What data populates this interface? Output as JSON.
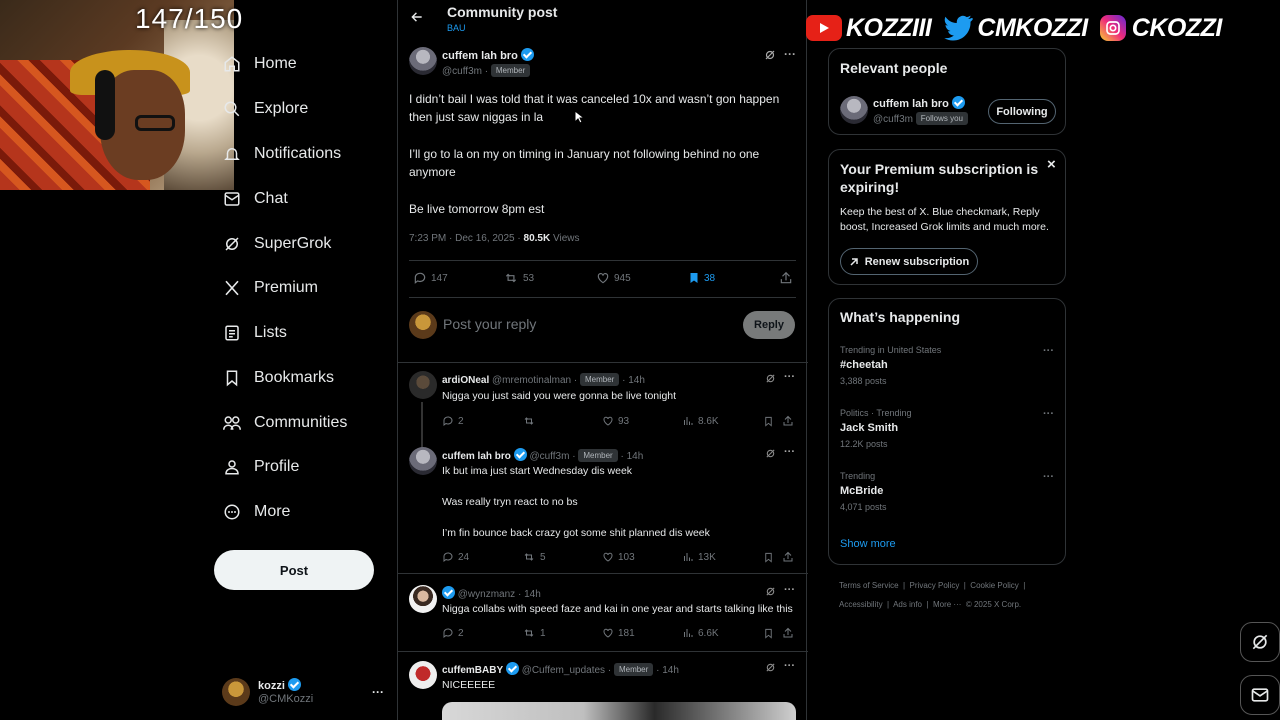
{
  "overlay": {
    "counter": "147/150",
    "banner": {
      "youtube": "KOZZIII",
      "twitter": "CMKOZZI",
      "instagram": "CKOZZI"
    }
  },
  "nav": {
    "items": [
      {
        "label": "Home",
        "icon": "home-icon"
      },
      {
        "label": "Explore",
        "icon": "search-icon"
      },
      {
        "label": "Notifications",
        "icon": "bell-icon"
      },
      {
        "label": "Chat",
        "icon": "chat-icon"
      },
      {
        "label": "SuperGrok",
        "icon": "grok-icon"
      },
      {
        "label": "Premium",
        "icon": "x-logo-icon"
      },
      {
        "label": "Lists",
        "icon": "lists-icon"
      },
      {
        "label": "Bookmarks",
        "icon": "bookmark-icon"
      },
      {
        "label": "Communities",
        "icon": "communities-icon"
      },
      {
        "label": "Profile",
        "icon": "profile-icon"
      },
      {
        "label": "More",
        "icon": "more-circle-icon"
      }
    ],
    "post_button": "Post",
    "account": {
      "name": "kozzi",
      "handle": "@CMKozzi",
      "more": "···"
    }
  },
  "header": {
    "title": "Community post",
    "subtitle": "BAU"
  },
  "main_post": {
    "author": "cuffem lah bro",
    "handle": "@cuff3m",
    "dot": "·",
    "badge": "Member",
    "paragraphs": [
      "I didn’t bail I was told that it was canceled 10x and wasn’t gon happen then just saw niggas in la",
      "I’ll go to la on my on timing in January not following behind no one anymore",
      "Be live tomorrow 8pm est"
    ],
    "timestamp": "7:23 PM · Dec 16, 2025 · ",
    "views": "80.5K",
    "views_label": " Views",
    "stats": {
      "replies": "147",
      "reposts": "53",
      "likes": "945",
      "bookmarks": "38"
    }
  },
  "reply_box": {
    "placeholder": "Post your reply",
    "button": "Reply"
  },
  "replies": [
    {
      "author": "ardiONeal",
      "handle": "@mremotinalman",
      "badge": "Member",
      "time": "14h",
      "lines": [
        "Nigga you just said you were gonna be live tonight"
      ],
      "stats": {
        "replies": "2",
        "reposts": "",
        "likes": "93",
        "views": "8.6K"
      }
    },
    {
      "author": "cuffem lah bro",
      "handle": "@cuff3m",
      "badge": "Member",
      "time": "14h",
      "lines": [
        "Ik but ima just start Wednesday dis week",
        "Was really tryn react to no bs",
        "I’m fin bounce back crazy got some shit planned dis week"
      ],
      "stats": {
        "replies": "24",
        "reposts": "5",
        "likes": "103",
        "views": "13K"
      }
    },
    {
      "author": "",
      "handle": "@wynzmanz",
      "badge": "",
      "time": "14h",
      "lines": [
        "Nigga collabs with speed faze and kai in one year and starts talking like this"
      ],
      "stats": {
        "replies": "2",
        "reposts": "1",
        "likes": "181",
        "views": "6.6K"
      }
    },
    {
      "author": "cuffemBABY",
      "handle": "@Cuffem_updates",
      "badge": "Member",
      "time": "14h",
      "lines": [
        "NICEEEEE"
      ],
      "stats": {}
    }
  ],
  "relevant": {
    "title": "Relevant people",
    "name": "cuffem lah bro",
    "handle": "@cuff3m",
    "follows_you": "Follows you",
    "button": "Following"
  },
  "premium": {
    "title": "Your Premium subscription is expiring!",
    "body": "Keep the best of X. Blue checkmark, Reply boost, Increased Grok limits and much more.",
    "button": "Renew subscription",
    "close": "×"
  },
  "happening": {
    "title": "What’s happening",
    "trends": [
      {
        "meta": "Trending in United States",
        "name": "#cheetah",
        "posts": "3,388 posts"
      },
      {
        "meta": "Politics · Trending",
        "name": "Jack Smith",
        "posts": "12.2K posts"
      },
      {
        "meta": "Trending",
        "name": "McBride",
        "posts": "4,071 posts"
      }
    ],
    "show_more": "Show more",
    "more": "···"
  },
  "footer": {
    "line1": "Terms of Service  |  Privacy Policy  |  Cookie Policy  |",
    "line2": "Accessibility  |  Ads info  |  More ···  © 2025 X Corp."
  },
  "colors": {
    "accent": "#1d9bf0",
    "background": "#000000",
    "border": "#2f3336",
    "muted": "#71767b"
  }
}
